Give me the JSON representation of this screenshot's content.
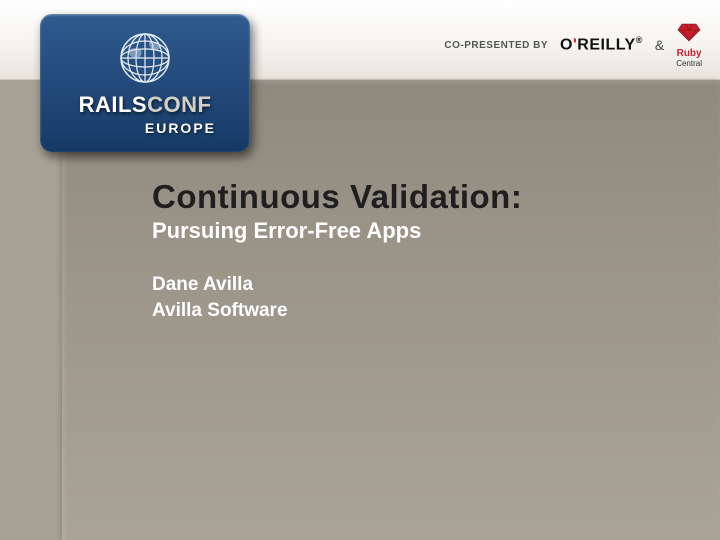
{
  "header": {
    "co_presented": "CO-PRESENTED BY",
    "sponsor1": "O'REILLY",
    "amp": "&",
    "sponsor2_ruby": "Ruby",
    "sponsor2_central": "Central"
  },
  "logo": {
    "line1_rails": "RAILS",
    "line1_conf": "CONF",
    "line2": "EUROPE"
  },
  "slide": {
    "title": "Continuous Validation:",
    "subtitle": "Pursuing Error-Free Apps",
    "author": "Dane Avilla",
    "company": "Avilla Software"
  }
}
